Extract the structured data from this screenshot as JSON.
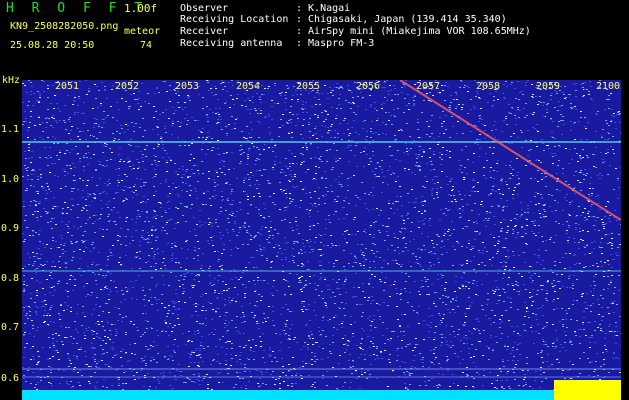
{
  "header": {
    "brand": "H R O F F T",
    "version": "1.00f",
    "filename": "KN9_2508282050.png",
    "mode": "meteor",
    "datetime": "25.08.28 20:50",
    "count": "74",
    "metadata": [
      {
        "label": "Observer",
        "value": ": K.Nagai"
      },
      {
        "label": "Receiving Location",
        "value": ": Chigasaki, Japan (139.414 35.340)"
      },
      {
        "label": "Receiver",
        "value": ": AirSpy mini (Miakejima VOR 108.65MHz)"
      },
      {
        "label": "Receiving antenna",
        "value": ": Maspro FM-3"
      }
    ]
  },
  "spectrogram": {
    "y_unit": "kHz",
    "y_ticks": [
      "1.1",
      "1.0",
      "0.9",
      "0.8",
      "0.7",
      "0.6"
    ],
    "x_ticks": [
      "2051",
      "2052",
      "2053",
      "2054",
      "2055",
      "2056",
      "2057",
      "2058",
      "2059",
      "2100"
    ],
    "colors": {
      "background": "#1a1aa0",
      "noise_bright": "#6fa8ff",
      "noise_white": "#dde8ff",
      "carrier": "#55d8e0",
      "meteor": "#ff6060",
      "baseline": "#00e0ff",
      "highlight": "#ffff00",
      "label": "#ffff55"
    }
  }
}
